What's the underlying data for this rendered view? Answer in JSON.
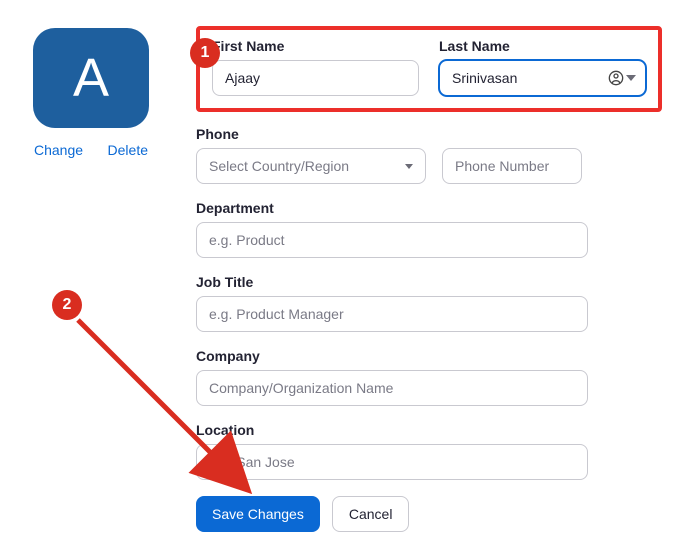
{
  "avatar": {
    "letter": "A",
    "change_label": "Change",
    "delete_label": "Delete"
  },
  "annotations": {
    "badge1": "1",
    "badge2": "2"
  },
  "fields": {
    "first_name": {
      "label": "First Name",
      "value": "Ajaay"
    },
    "last_name": {
      "label": "Last Name",
      "value": "Srinivasan"
    },
    "phone": {
      "label": "Phone",
      "country_placeholder": "Select Country/Region",
      "number_placeholder": "Phone Number"
    },
    "department": {
      "label": "Department",
      "placeholder": "e.g. Product"
    },
    "job_title": {
      "label": "Job Title",
      "placeholder": "e.g. Product Manager"
    },
    "company": {
      "label": "Company",
      "placeholder": "Company/Organization Name"
    },
    "location": {
      "label": "Location",
      "placeholder": "e.g. San Jose"
    }
  },
  "buttons": {
    "save": "Save Changes",
    "cancel": "Cancel"
  }
}
